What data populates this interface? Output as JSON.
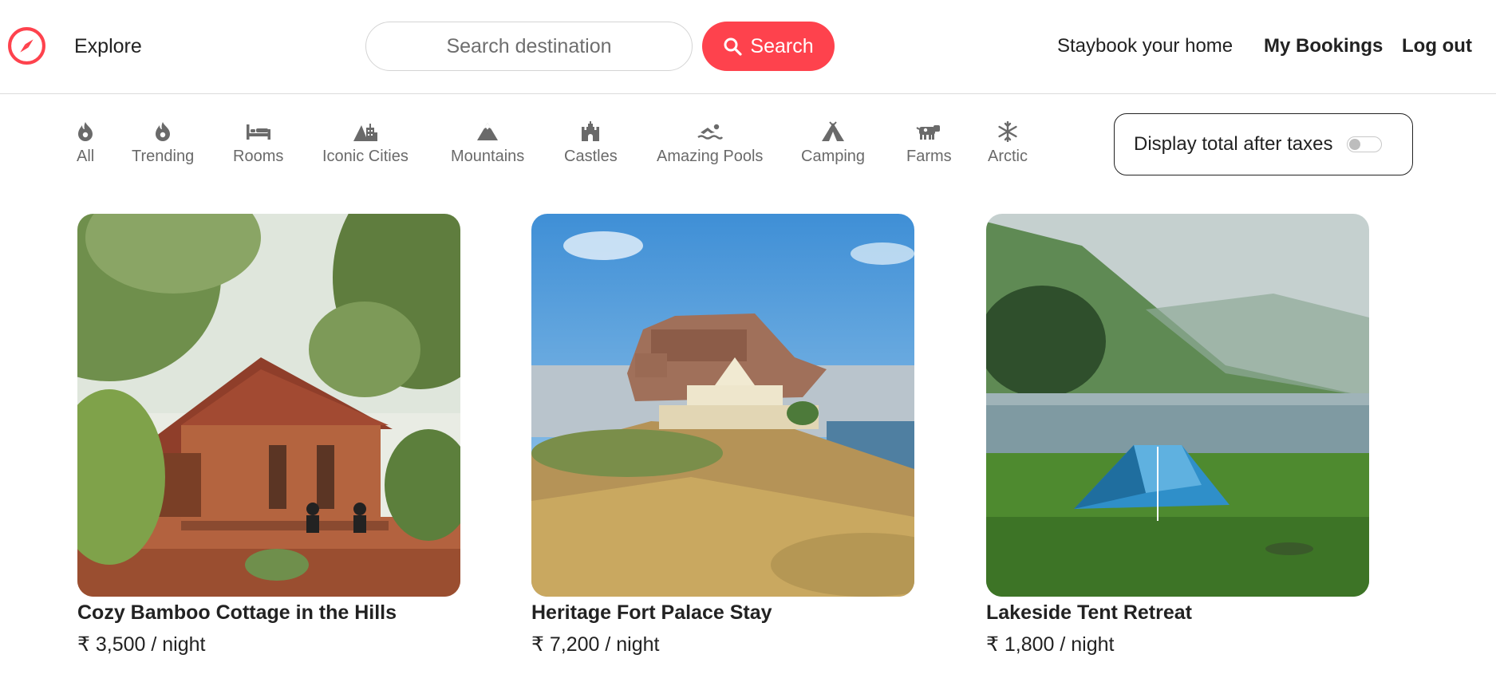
{
  "navbar": {
    "logo_icon": "compass-icon",
    "explore_label": "Explore",
    "search": {
      "placeholder": "Search destination",
      "value": "",
      "button_label": "Search",
      "button_icon": "search-icon"
    },
    "links": {
      "staybook": "Staybook your home",
      "bookings": "My Bookings",
      "logout": "Log out"
    },
    "accent_color": "#fe424d"
  },
  "filters": [
    {
      "label": "All",
      "icon": "fire-icon"
    },
    {
      "label": "Trending",
      "icon": "fire-icon"
    },
    {
      "label": "Rooms",
      "icon": "bed-icon"
    },
    {
      "label": "Iconic Cities",
      "icon": "city-icon"
    },
    {
      "label": "Mountains",
      "icon": "mountain-icon"
    },
    {
      "label": "Castles",
      "icon": "castle-icon"
    },
    {
      "label": "Amazing Pools",
      "icon": "swimmer-icon"
    },
    {
      "label": "Camping",
      "icon": "tent-icon"
    },
    {
      "label": "Farms",
      "icon": "cow-icon"
    },
    {
      "label": "Arctic",
      "icon": "snowflake-icon"
    }
  ],
  "tax_toggle": {
    "label": "Display total after taxes",
    "enabled": false
  },
  "listings": [
    {
      "title": "Cozy Bamboo Cottage in the Hills",
      "price": "₹ 3,500 / night"
    },
    {
      "title": "Heritage Fort Palace Stay",
      "price": "₹ 7,200 / night"
    },
    {
      "title": "Lakeside Tent Retreat",
      "price": "₹ 1,800 / night"
    }
  ]
}
